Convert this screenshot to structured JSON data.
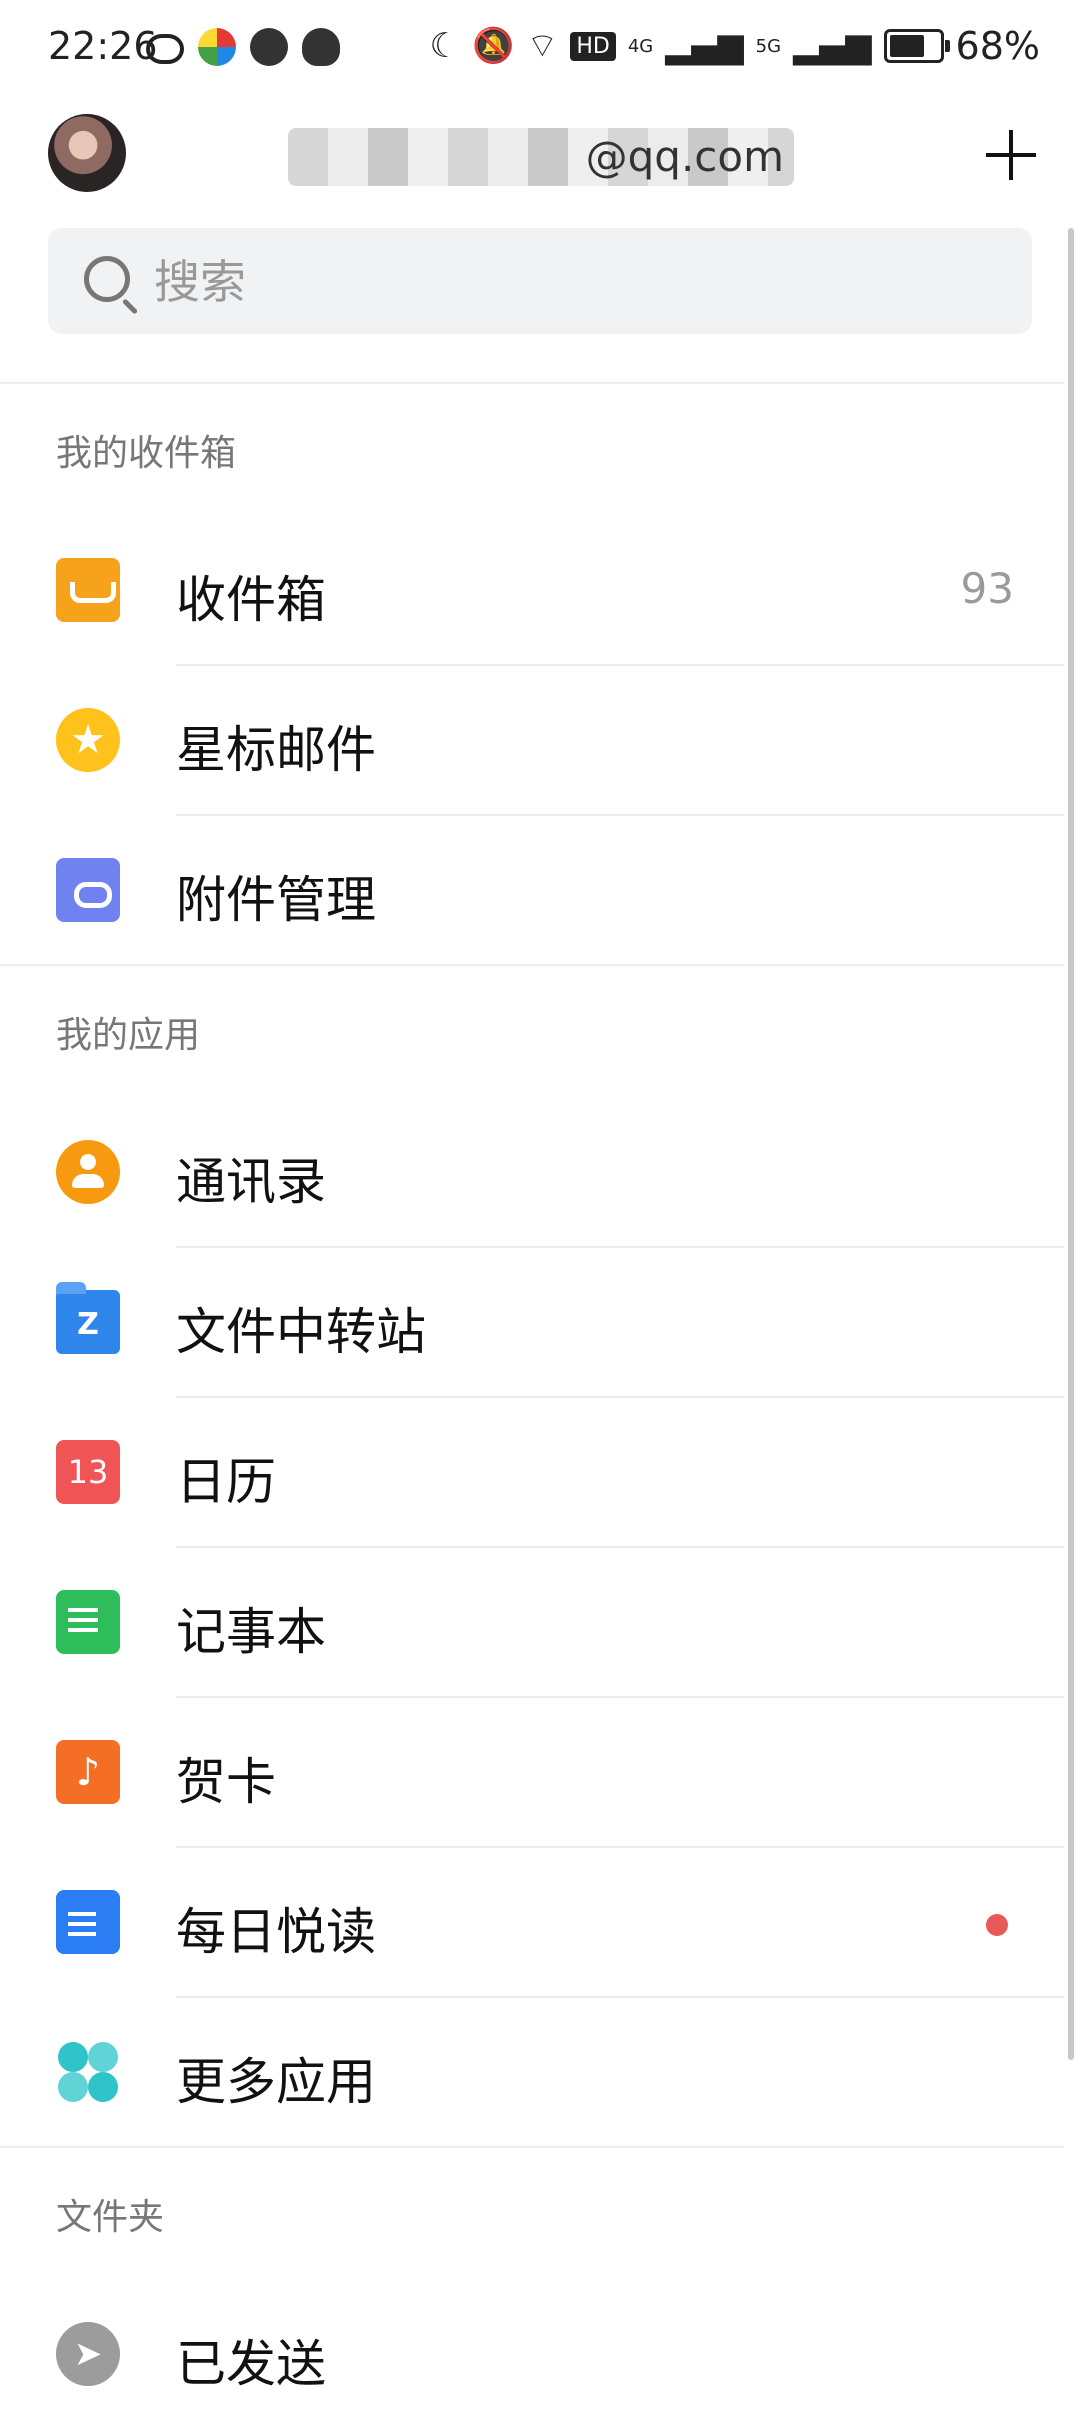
{
  "status_bar": {
    "time": "22:26",
    "network_hd": "HD",
    "network_4g": "4G",
    "network_5g": "5G",
    "battery": "68%"
  },
  "header": {
    "account_email": "@qq.com"
  },
  "search": {
    "placeholder": "搜索"
  },
  "sections": {
    "inbox_title": "我的收件箱",
    "apps_title": "我的应用",
    "folders_title": "文件夹"
  },
  "inbox_items": [
    {
      "label": "收件箱",
      "count": "93",
      "icon": "inbox-icon",
      "color": "#f7a21b"
    },
    {
      "label": "星标邮件",
      "icon": "star-icon",
      "color": "#ffc21c"
    },
    {
      "label": "附件管理",
      "icon": "attachment-icon",
      "color": "#6f82ef"
    }
  ],
  "app_items": [
    {
      "label": "通讯录",
      "icon": "contacts-icon",
      "color": "#f89a10"
    },
    {
      "label": "文件中转站",
      "icon": "file-transfer-icon",
      "color": "#2f86ea",
      "icon_text": "Z"
    },
    {
      "label": "日历",
      "icon": "calendar-icon",
      "color": "#f05454",
      "icon_text": "13"
    },
    {
      "label": "记事本",
      "icon": "notepad-icon",
      "color": "#2fbd5b"
    },
    {
      "label": "贺卡",
      "icon": "greeting-card-icon",
      "color": "#f46e25"
    },
    {
      "label": "每日悦读",
      "icon": "daily-reading-icon",
      "color": "#2a7df2",
      "unread_dot": true
    },
    {
      "label": "更多应用",
      "icon": "more-apps-icon",
      "color": "#2ec4c9"
    }
  ],
  "folder_items": [
    {
      "label": "已发送",
      "icon": "sent-icon",
      "color": "#9c9c9c"
    }
  ]
}
